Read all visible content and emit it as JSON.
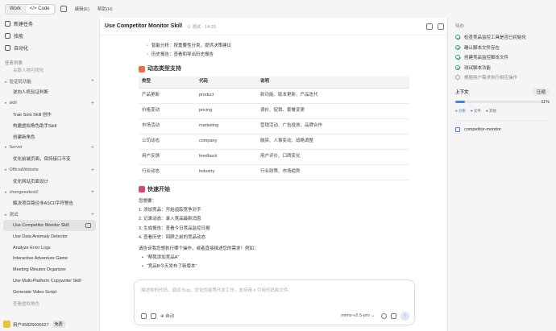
{
  "topbar": {
    "work": "Work",
    "code": "</> Code",
    "menu": [
      "编辑(E)",
      "帮助(H)"
    ]
  },
  "sidebar": {
    "top": [
      "新建任务",
      "技能",
      "自动化"
    ],
    "task_list_title": "任务列表",
    "rows": [
      {
        "type": "item",
        "label": "关联人物可视化",
        "muted": true
      },
      {
        "type": "group",
        "label": "验证码功能"
      },
      {
        "type": "item",
        "label": "逆向人机验证判断"
      },
      {
        "type": "group",
        "label": "skill"
      },
      {
        "type": "item",
        "label": "Trae Solo Skill 创作"
      },
      {
        "type": "item",
        "label": "构建虚拟角色助手Skill"
      },
      {
        "type": "item",
        "label": "创建新角色"
      },
      {
        "type": "group",
        "label": "Server"
      },
      {
        "type": "item",
        "label": "优化前端页面，保持接口不变"
      },
      {
        "type": "group",
        "label": "OfficialWebsite"
      },
      {
        "type": "item",
        "label": "优化网站页面设计"
      },
      {
        "type": "group",
        "label": "vhengeeetest2"
      },
      {
        "type": "item",
        "label": "解决项目路径非ASCII字符警告"
      },
      {
        "type": "group",
        "label": "测试"
      },
      {
        "type": "item",
        "label": "Use Competitor Monitor Skill",
        "active": true
      },
      {
        "type": "item",
        "label": "Use Data Anomaly Detector"
      },
      {
        "type": "item",
        "label": "Analyze Error Logs"
      },
      {
        "type": "item",
        "label": "Interactive Adventure Game"
      },
      {
        "type": "item",
        "label": "Meeting Minutes Organizer"
      },
      {
        "type": "item",
        "label": "Use Multi-Platform Copywriter Skill"
      },
      {
        "type": "item",
        "label": "Generate Video Script"
      },
      {
        "type": "item",
        "label": "查看虚拟角色",
        "muted": true
      }
    ],
    "user": {
      "name": "用户05825006627",
      "badge": "免费"
    }
  },
  "main": {
    "title": "Use Competitor Monitor Skill",
    "status": "⊙ 测试 · 14:23",
    "bullets": [
      "智能分析：按重要性分类，提供决策建议",
      "历史报告：查看和导出历史报告"
    ],
    "section1": "动态类型支持",
    "table": {
      "headers": [
        "类型",
        "代码",
        "说明"
      ],
      "rows": [
        [
          "产品更新",
          "product",
          "新功能、版本更新、产品迭代"
        ],
        [
          "价格变动",
          "pricing",
          "调价、促销、套餐变更"
        ],
        [
          "市场活动",
          "marketing",
          "营销活动、广告投放、品牌合作"
        ],
        [
          "公司动态",
          "company",
          "融资、人事变动、战略调整"
        ],
        [
          "用户反馈",
          "feedback",
          "用户评价、口碑变化"
        ],
        [
          "行业动态",
          "industry",
          "行业政策、市场趋势"
        ]
      ]
    },
    "section2": "快速开始",
    "intro": "您想要：",
    "steps": [
      "1. 添加竞品：开始追踪竞争对手",
      "2. 记录动态：录入竞品最新消息",
      "3. 生成报告：查看今日竞品监控日报",
      "4. 查看历史：回顾之前的竞品动态"
    ],
    "prompt": "请告诉我您想执行哪个操作，或者直接描述您的需求！例如：",
    "examples": [
      "“帮我添加竞品A”",
      "“竞品B今天发布了新版本”"
    ],
    "composer": {
      "placeholder": "描述你的代码、调试 Bug、优化性能等开发工作，支持用 # 引用代码和文件。",
      "mode": "⊕ 自动",
      "model": "mimo-v2.5-pro ⌄",
      "send": "↑"
    }
  },
  "right": {
    "todo_title": "待办",
    "todos": [
      {
        "label": "检查竞品监控工具是否已初始化",
        "done": true
      },
      {
        "label": "确认脚本文件存在",
        "done": true
      },
      {
        "label": "创建竞品监控脚本文件",
        "done": true
      },
      {
        "label": "测试脚本功能",
        "done": true
      },
      {
        "label": "根据用户需求执行相应操作",
        "done": false
      }
    ],
    "context_title": "上下文",
    "compress": "压缩",
    "usage_percent": 11,
    "usage_label": "11%",
    "legend": [
      "● 对象",
      "● 文件",
      "● 其他"
    ],
    "skill": "competitor-monitor"
  },
  "colors": {
    "accent": "#4a7fe0",
    "done": "#2aa35a",
    "section_icon1": "#e6704a",
    "section_icon2": "#d64a6a"
  }
}
